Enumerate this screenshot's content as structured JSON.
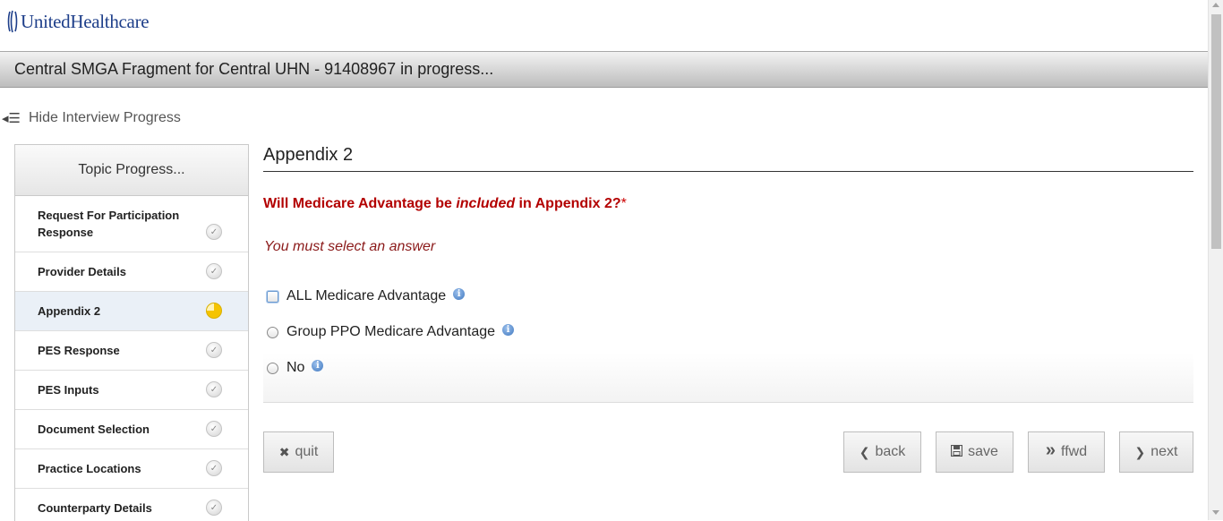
{
  "header": {
    "logo_text": "UnitedHealthcare",
    "title": "Central SMGA Fragment for Central UHN - 91408967 in progress..."
  },
  "progress_toggle": {
    "label": "Hide Interview Progress"
  },
  "topics": {
    "header": "Topic Progress...",
    "items": [
      {
        "label": "Request For Participation Response",
        "status": "complete"
      },
      {
        "label": "Provider Details",
        "status": "complete"
      },
      {
        "label": "Appendix 2",
        "status": "in-progress"
      },
      {
        "label": "PES Response",
        "status": "complete"
      },
      {
        "label": "PES Inputs",
        "status": "complete"
      },
      {
        "label": "Document Selection",
        "status": "complete"
      },
      {
        "label": "Practice Locations",
        "status": "complete"
      },
      {
        "label": "Counterparty Details",
        "status": "complete"
      }
    ]
  },
  "main": {
    "section_title": "Appendix 2",
    "question": {
      "prefix": "Will Medicare Advantage be ",
      "emphasis": "included",
      "suffix": " in Appendix 2?",
      "required_mark": "*"
    },
    "error": "You must select an answer",
    "options": [
      {
        "label": "ALL Medicare Advantage",
        "info_icon": "i"
      },
      {
        "label": "Group PPO Medicare Advantage",
        "info_icon": "i"
      },
      {
        "label": "No",
        "info_icon": "i"
      }
    ]
  },
  "buttons": {
    "quit": {
      "label": "quit",
      "icon": "✖"
    },
    "back": {
      "label": "back",
      "icon": "❮"
    },
    "save": {
      "label": "save",
      "icon": "💾"
    },
    "ffwd": {
      "label": "ffwd",
      "icon": "»"
    },
    "next": {
      "label": "next",
      "icon": "❯"
    }
  },
  "colors": {
    "question": "#b30000",
    "error": "#8b1a1a",
    "logo": "#1e3f8a",
    "in_progress": "#f5c400"
  }
}
